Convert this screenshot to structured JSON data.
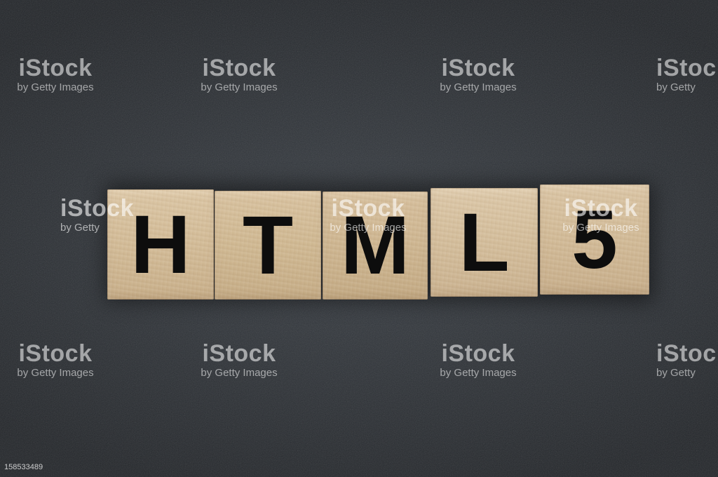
{
  "photo": {
    "subject": "HTML5",
    "tiles": [
      "H",
      "T",
      "M",
      "L",
      "5"
    ],
    "colors": {
      "background": "#2e3237",
      "wood": "#d3bc98",
      "letters": "#0d0d0d"
    }
  },
  "watermark": {
    "logo": "iStock",
    "credit": "by Getty Images",
    "credit_short": "by Getty"
  },
  "image_id": "158533489"
}
